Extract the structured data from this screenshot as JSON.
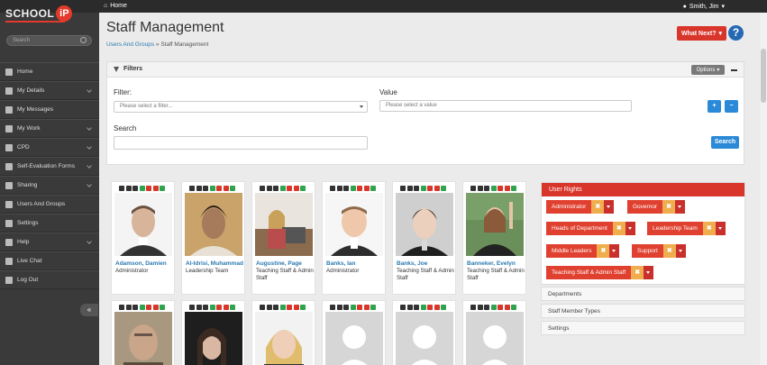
{
  "topbar": {
    "logo": "SCHOOL",
    "logo_badge": "iP",
    "home": "Home",
    "user": "Smith, Jim"
  },
  "sidebar": {
    "search_placeholder": "Search",
    "items": [
      {
        "label": "Home",
        "chevron": false
      },
      {
        "label": "My Details",
        "chevron": true
      },
      {
        "label": "My Messages",
        "chevron": false
      },
      {
        "label": "My Work",
        "chevron": true
      },
      {
        "label": "CPD",
        "chevron": true
      },
      {
        "label": "Self-Evaluation Forms",
        "chevron": true
      },
      {
        "label": "Sharing",
        "chevron": true
      },
      {
        "label": "Users And Groups",
        "chevron": false
      },
      {
        "label": "Settings",
        "chevron": false
      },
      {
        "label": "Help",
        "chevron": true
      },
      {
        "label": "Live Chat",
        "chevron": false
      },
      {
        "label": "Log Out",
        "chevron": false
      }
    ],
    "collapse": "«"
  },
  "header": {
    "title": "Staff Management",
    "breadcrumb_link": "Users And Groups",
    "breadcrumb_sep": " » ",
    "breadcrumb_current": "Staff Management",
    "what_next": "What Next?",
    "help": "?"
  },
  "filters": {
    "title": "Filters",
    "options": "Options",
    "filter_label": "Filter:",
    "filter_placeholder": "Please select a filter...",
    "value_label": "Value",
    "value_placeholder": "Please select a value",
    "search_label": "Search",
    "search_button": "Search",
    "add": "+",
    "remove": "−"
  },
  "staff": [
    {
      "name": "Adamson, Damien",
      "role": "Administrator"
    },
    {
      "name": "Al-Idrisi, Muhammad",
      "role": "Leadership Team"
    },
    {
      "name": "Augustine, Page",
      "role": "Teaching Staff & Admin Staff"
    },
    {
      "name": "Banks, Ian",
      "role": "Administrator"
    },
    {
      "name": "Banks, Joe",
      "role": "Teaching Staff & Admin Staff"
    },
    {
      "name": "Banneker, Evelyn",
      "role": "Teaching Staff & Admin Staff"
    }
  ],
  "rights": {
    "title": "User Rights",
    "tags": [
      "Administrator",
      "Governor",
      "Heads of Department",
      "Leadership Team",
      "Middle Leaders",
      "Support",
      "Teaching Staff & Admin Staff"
    ],
    "remove_glyph": "✖"
  },
  "accordion": [
    "Departments",
    "Staff Member Types",
    "Settings"
  ]
}
